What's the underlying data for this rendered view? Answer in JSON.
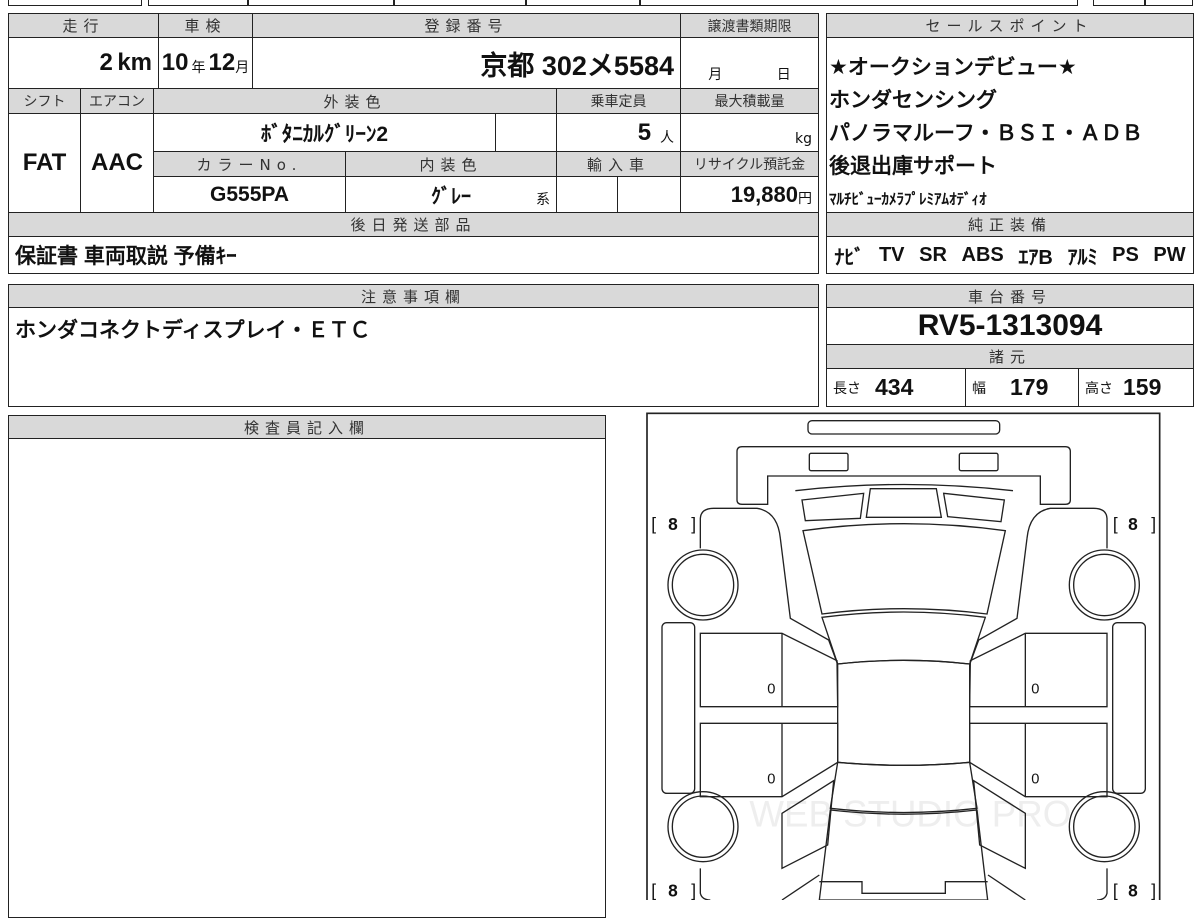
{
  "main": {
    "headers": {
      "mileage": "走行",
      "inspection": "車検",
      "registration": "登録番号",
      "transfer_deadline": "譲渡書類期限",
      "shift": "シフト",
      "aircon": "エアコン",
      "exterior_color": "外装色",
      "capacity": "乗車定員",
      "max_load": "最大積載量",
      "color_no": "カラーNo.",
      "interior_color": "内装色",
      "imported": "輸入車",
      "recycle_fee": "リサイクル預託金",
      "later_parts": "後日発送部品"
    },
    "mileage": "2",
    "mileage_unit": "km",
    "inspection_year": "10",
    "year_unit": "年",
    "inspection_month": "12",
    "month_unit": "月",
    "registration": "京都 302メ5584",
    "deadline_month": "月",
    "deadline_day": "日",
    "shift": "FAT",
    "aircon": "AAC",
    "exterior_color": "ﾎﾞﾀﾆｶﾙｸﾞﾘｰﾝ2",
    "capacity": "5",
    "capacity_unit": "人",
    "load_unit": "kg",
    "color_no": "G555PA",
    "interior_color": "ｸﾞﾚｰ",
    "interior_suffix": "系",
    "recycle_fee": "19,880",
    "yen": "円",
    "later_parts": "保証書 車両取説 予備ｷｰ"
  },
  "sales": {
    "header": "セールスポイント",
    "lines": [
      "★オークションデビュー★",
      "ホンダセンシング",
      "パノラマルーフ・ＢＳＩ・ＡＤＢ",
      "後退出庫サポート",
      "ﾏﾙﾁﾋﾞｭｰｶﾒﾗﾌﾟﾚﾐｱﾑｵﾃﾞｨｵ"
    ]
  },
  "equipment": {
    "header": "純正装備",
    "items": [
      "ﾅﾋﾞ",
      "TV",
      "SR",
      "ABS",
      "ｴｱB",
      "ｱﾙﾐ",
      "PS",
      "PW"
    ]
  },
  "notes": {
    "header": "注意事項欄",
    "text": "ホンダコネクトディスプレイ・ＥＴＣ"
  },
  "chassis": {
    "header": "車台番号",
    "number": "RV5-1313094",
    "spec_header": "諸元",
    "length_label": "長さ",
    "length": "434",
    "width_label": "幅",
    "width": "179",
    "height_label": "高さ",
    "height": "159"
  },
  "inspector": {
    "header": "検査員記入欄"
  },
  "diagram": {
    "corners": [
      "8",
      "8",
      "8",
      "8"
    ],
    "doors": [
      "0",
      "0",
      "0",
      "0"
    ],
    "watermark": "WEB STUDIO PRO"
  }
}
